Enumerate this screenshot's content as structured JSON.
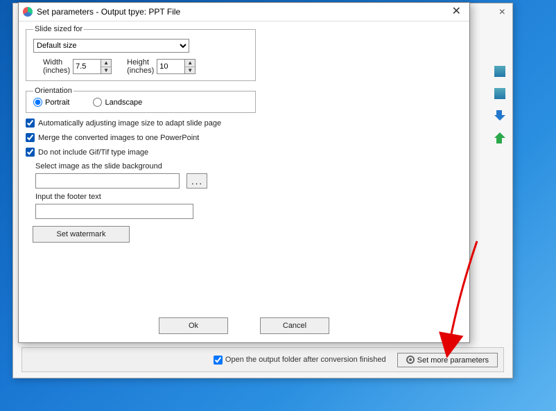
{
  "dialog": {
    "title": "Set parameters - Output tpye: PPT File",
    "groups": {
      "slidesize": {
        "legend": "Slide sized for",
        "preset_selected": "Default size",
        "width_label": "Width\n(inches)",
        "width_value": "7.5",
        "height_label": "Height\n(inches)",
        "height_value": "10"
      },
      "orientation": {
        "legend": "Orientation",
        "portrait": "Portrait",
        "landscape": "Landscape"
      }
    },
    "checks": {
      "auto_adjust": "Automatically adjusting image size to adapt slide page",
      "merge": "Merge the converted images to one PowerPoint",
      "no_giftif": "Do not include Gif/Tif type image"
    },
    "bg_label": "Select image as the slide background",
    "bg_value": "",
    "footer_label": "Input the footer text",
    "footer_value": "",
    "watermark_btn": "Set watermark",
    "ok": "Ok",
    "cancel": "Cancel"
  },
  "parent": {
    "open_after": "Open the output folder after conversion finished",
    "set_more": "Set more parameters"
  }
}
